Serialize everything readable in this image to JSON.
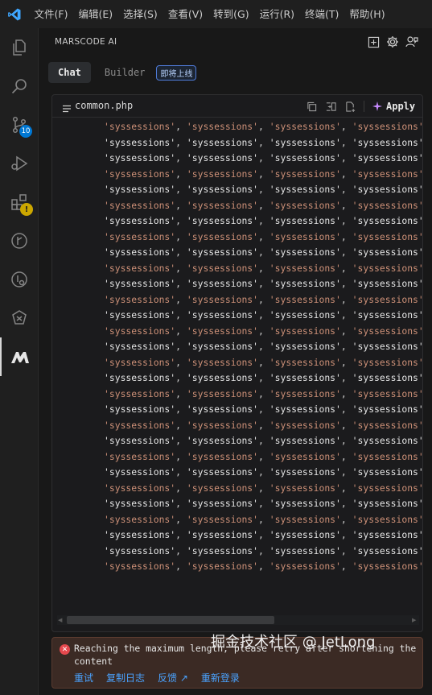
{
  "menu": [
    "文件(F)",
    "编辑(E)",
    "选择(S)",
    "查看(V)",
    "转到(G)",
    "运行(R)",
    "终端(T)",
    "帮助(H)"
  ],
  "activity_bar": {
    "source_control_badge": "10",
    "extensions_warning": "!"
  },
  "panel": {
    "title": "MARSCODE AI"
  },
  "tabs": {
    "chat": "Chat",
    "builder": "Builder",
    "builder_badge": "即将上线"
  },
  "code_block": {
    "file_name": "common.php",
    "apply_label": "Apply",
    "token": "'syssessions'",
    "separator": ", ",
    "line_colors": [
      "orange",
      "white",
      "white",
      "orange",
      "white",
      "orange",
      "white",
      "orange",
      "white",
      "orange",
      "white",
      "orange",
      "white",
      "orange",
      "white",
      "orange",
      "white",
      "orange",
      "white",
      "orange",
      "white",
      "orange",
      "white",
      "orange",
      "white",
      "orange",
      "white",
      "white",
      "orange"
    ]
  },
  "error": {
    "message": "Reaching the maximum length, please retry after shortening the content",
    "actions": [
      "重试",
      "复制日志",
      "反馈 ↗",
      "重新登录"
    ]
  },
  "watermark": "掘金技术社区 @ JetLong",
  "colors": {
    "accent": "#0078d4",
    "string_orange": "#ce9178",
    "error_red": "#e5484d",
    "link_blue": "#4aa3ff"
  }
}
